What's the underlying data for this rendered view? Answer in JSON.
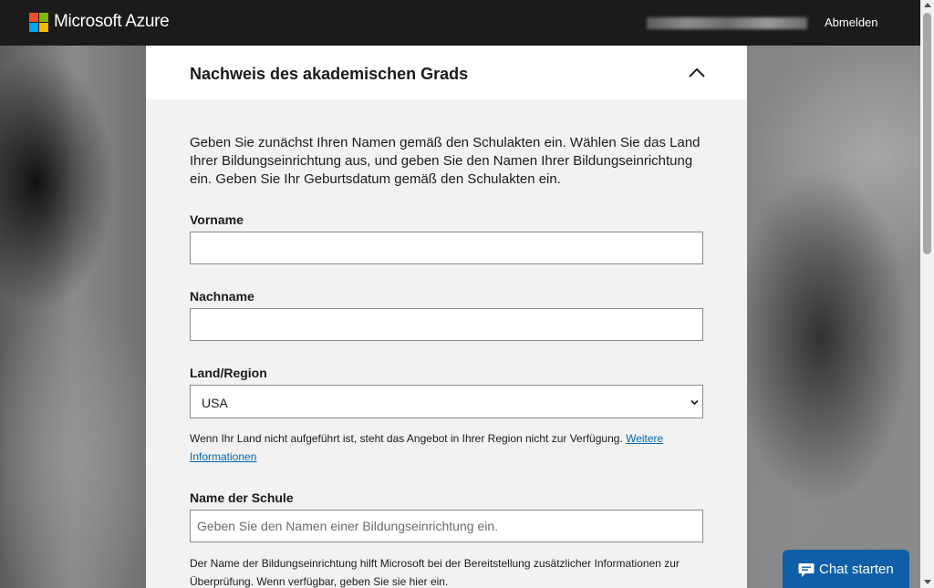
{
  "header": {
    "brand": "Microsoft Azure",
    "signout_label": "Abmelden",
    "logo_colors": [
      "#f25022",
      "#7fba00",
      "#00a4ef",
      "#ffb900"
    ]
  },
  "card": {
    "title": "Nachweis des akademischen Grads",
    "intro": "Geben Sie zunächst Ihren Namen gemäß den Schulakten ein. Wählen Sie das Land Ihrer Bildungseinrichtung aus, und geben Sie den Namen Ihrer Bildungseinrichtung ein. Geben Sie Ihr Geburtsdatum gemäß den Schulakten ein.",
    "first_name": {
      "label": "Vorname",
      "value": ""
    },
    "last_name": {
      "label": "Nachname",
      "value": ""
    },
    "country": {
      "label": "Land/Region",
      "selected": "USA",
      "note": "Wenn Ihr Land nicht aufgeführt ist, steht das Angebot in Ihrer Region nicht zur Verfügung.",
      "link": "Weitere Informationen"
    },
    "school": {
      "label": "Name der Schule",
      "placeholder": "Geben Sie den Namen einer Bildungseinrichtung ein.",
      "note": "Der Name der Bildungseinrichtung hilft Microsoft bei der Bereitstellung zusätzlicher Informationen zur Überprüfung. Wenn verfügbar, geben Sie sie hier ein."
    }
  },
  "chat": {
    "label": "Chat starten",
    "color": "#0f5fa8"
  }
}
